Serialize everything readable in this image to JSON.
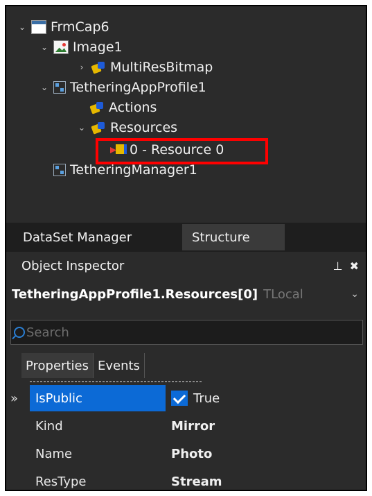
{
  "tree": {
    "nodes": [
      {
        "label": "FrmCap6",
        "icon": "form-icon"
      },
      {
        "label": "Image1",
        "icon": "image-icon"
      },
      {
        "label": "MultiResBitmap",
        "icon": "component-icon"
      },
      {
        "label": "TetheringAppProfile1",
        "icon": "tethering-icon"
      },
      {
        "label": "Actions",
        "icon": "component-icon"
      },
      {
        "label": "Resources",
        "icon": "component-icon"
      },
      {
        "label": "0 - Resource 0",
        "icon": "resource-icon"
      },
      {
        "label": "TetheringManager1",
        "icon": "tethering-icon"
      }
    ]
  },
  "tabs": {
    "dataset_manager": "DataSet Manager",
    "structure": "Structure"
  },
  "inspector": {
    "title": "Object Inspector",
    "selected_object": "TetheringAppProfile1.Resources[0]",
    "selected_type": "TLocal",
    "search_placeholder": "Search",
    "tab_properties": "Properties",
    "tab_events": "Events",
    "properties": [
      {
        "name": "IsPublic",
        "value": "True",
        "checked": true
      },
      {
        "name": "Kind",
        "value": "Mirror"
      },
      {
        "name": "Name",
        "value": "Photo"
      },
      {
        "name": "ResType",
        "value": "Stream"
      }
    ]
  },
  "colors": {
    "background": "#2b2b2b",
    "selection": "#0c6ad6",
    "highlight_box": "#ff0000"
  }
}
